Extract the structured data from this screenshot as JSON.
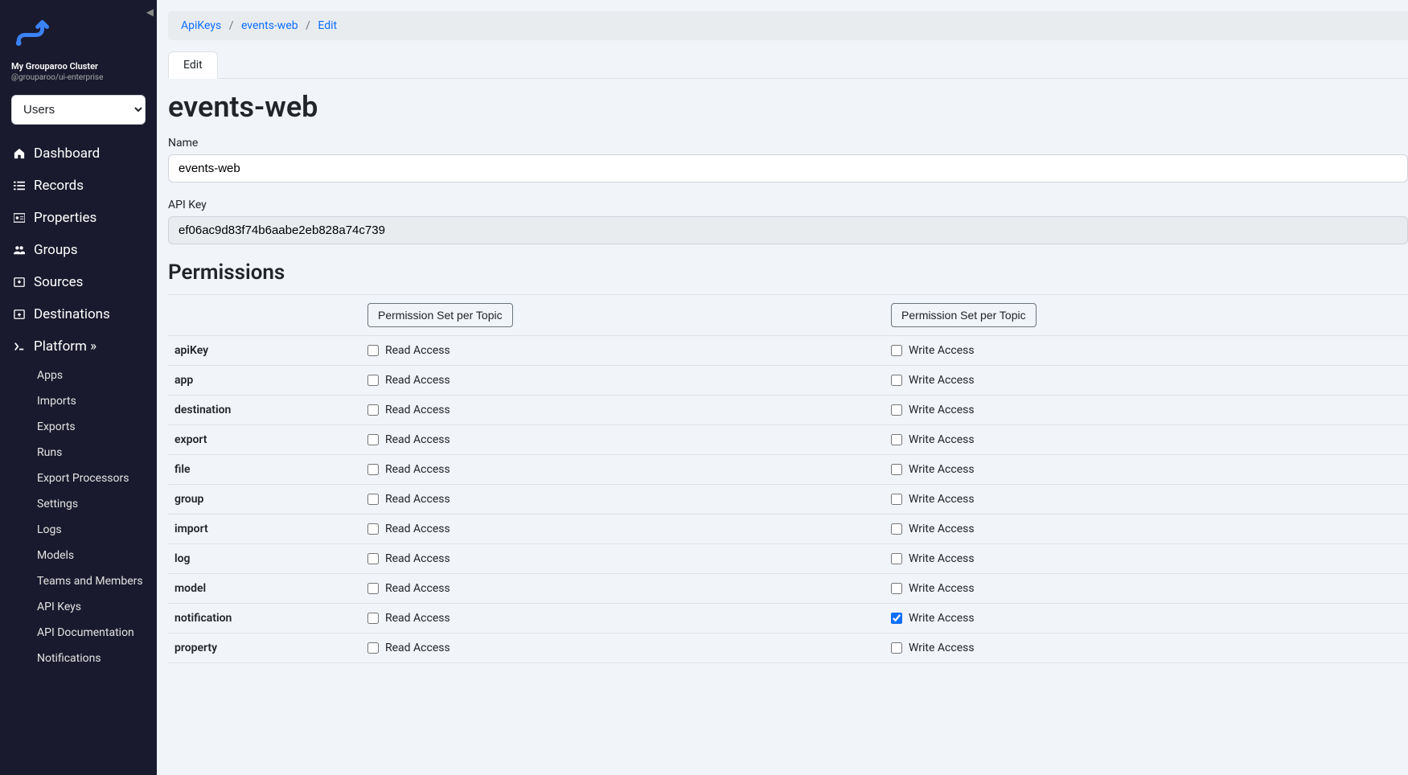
{
  "sidebar": {
    "cluster_name": "My Grouparoo Cluster",
    "package": "@grouparoo/ui-enterprise",
    "model_select": "Users",
    "nav": [
      {
        "icon": "home",
        "label": "Dashboard"
      },
      {
        "icon": "list",
        "label": "Records"
      },
      {
        "icon": "id-card",
        "label": "Properties"
      },
      {
        "icon": "users",
        "label": "Groups"
      },
      {
        "icon": "download",
        "label": "Sources"
      },
      {
        "icon": "upload",
        "label": "Destinations"
      },
      {
        "icon": "terminal",
        "label": "Platform »"
      }
    ],
    "subnav": [
      "Apps",
      "Imports",
      "Exports",
      "Runs",
      "Export Processors",
      "Settings",
      "Logs",
      "Models",
      "Teams and Members",
      "API Keys",
      "API Documentation",
      "Notifications"
    ]
  },
  "breadcrumb": {
    "items": [
      "ApiKeys",
      "events-web",
      "Edit"
    ]
  },
  "tabs": {
    "edit": "Edit"
  },
  "page": {
    "title": "events-web",
    "name_label": "Name",
    "name_value": "events-web",
    "apikey_label": "API Key",
    "apikey_value": "ef06ac9d83f74b6aabe2eb828a74c739"
  },
  "permissions": {
    "heading": "Permissions",
    "read_header_button": "Permission Set per Topic",
    "write_header_button": "Permission Set per Topic",
    "read_label": "Read Access",
    "write_label": "Write Access",
    "rows": [
      {
        "topic": "apiKey",
        "read": false,
        "write": false
      },
      {
        "topic": "app",
        "read": false,
        "write": false
      },
      {
        "topic": "destination",
        "read": false,
        "write": false
      },
      {
        "topic": "export",
        "read": false,
        "write": false
      },
      {
        "topic": "file",
        "read": false,
        "write": false
      },
      {
        "topic": "group",
        "read": false,
        "write": false
      },
      {
        "topic": "import",
        "read": false,
        "write": false
      },
      {
        "topic": "log",
        "read": false,
        "write": false
      },
      {
        "topic": "model",
        "read": false,
        "write": false
      },
      {
        "topic": "notification",
        "read": false,
        "write": true
      },
      {
        "topic": "property",
        "read": false,
        "write": false
      }
    ]
  }
}
